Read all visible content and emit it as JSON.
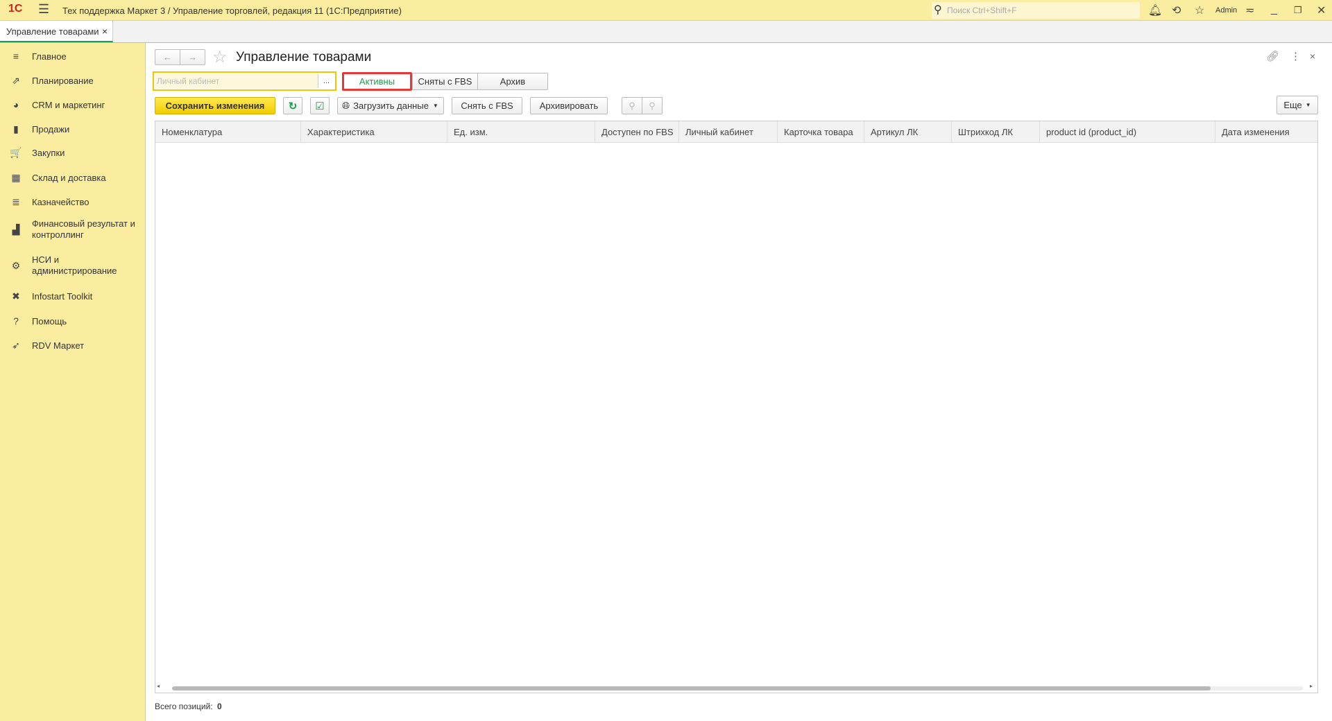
{
  "titlebar": {
    "logo": "1С",
    "title": "Тех поддержка Маркет 3 / Управление торговлей, редакция 11  (1С:Предприятие)",
    "search_placeholder": "Поиск Ctrl+Shift+F",
    "user": "Admin"
  },
  "tabs": [
    {
      "label": "Управление товарами",
      "close": "×"
    }
  ],
  "sidebar": {
    "items": [
      {
        "label": "Главное",
        "icon": "≡"
      },
      {
        "label": "Планирование",
        "icon": "⇗"
      },
      {
        "label": "CRM и маркетинг",
        "icon": "◕"
      },
      {
        "label": "Продажи",
        "icon": "▮"
      },
      {
        "label": "Закупки",
        "icon": "🛒"
      },
      {
        "label": "Склад и доставка",
        "icon": "▦"
      },
      {
        "label": "Казначейство",
        "icon": "≣"
      },
      {
        "label": "Финансовый результат и контроллинг",
        "icon": "▟"
      },
      {
        "label": "НСИ и администрирование",
        "icon": "⚙"
      },
      {
        "label": "Infostart Toolkit",
        "icon": "✖"
      },
      {
        "label": "Помощь",
        "icon": "?"
      },
      {
        "label": "RDV Маркет",
        "icon": "➶"
      }
    ]
  },
  "form": {
    "title": "Управление товарами",
    "filter_placeholder": "Личный кабинет",
    "filter_btn": "...",
    "status_tabs": [
      "Активны",
      "Сняты с FBS",
      "Архив"
    ],
    "active_tab_color": "#1a9e4b",
    "toolbar": {
      "save": "Сохранить изменения",
      "load": "Загрузить данные",
      "remove_fbs": "Снять с FBS",
      "archive": "Архивировать",
      "more": "Еще"
    },
    "columns": [
      "Номенклатура",
      "Характеристика",
      "Ед. изм.",
      "Доступен по FBS",
      "Личный кабинет",
      "Карточка товара",
      "Артикул ЛК",
      "Штрихкод ЛК",
      "product id (product_id)",
      "Дата изменения"
    ],
    "footer_label": "Всего позиций:",
    "footer_count": "0"
  }
}
